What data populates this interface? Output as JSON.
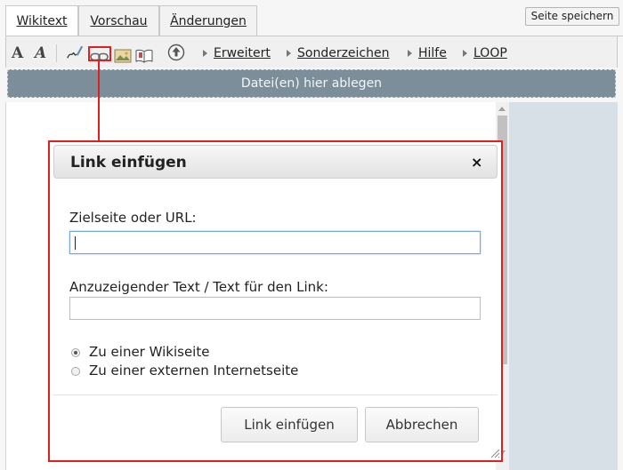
{
  "tabs": [
    {
      "label": "Wikitext"
    },
    {
      "label": "Vorschau"
    },
    {
      "label": "Änderungen"
    }
  ],
  "save_button": "Seite speichern",
  "toolbar": {
    "icons": [
      "bold-icon",
      "italic-icon",
      "signature-icon",
      "link-icon",
      "image-icon",
      "book-icon",
      "upload-icon"
    ],
    "menus": [
      {
        "label": "Erweitert"
      },
      {
        "label": "Sonderzeichen"
      },
      {
        "label": "Hilfe"
      },
      {
        "label": "LOOP"
      }
    ]
  },
  "dropzone": "Datei(en) hier ablegen",
  "dialog": {
    "title": "Link einfügen",
    "close": "×",
    "target_label": "Zielseite oder URL:",
    "target_value": "",
    "text_label": "Anzuzeigender Text / Text für den Link:",
    "text_value": "",
    "radio_options": [
      {
        "label": "Zu einer Wikiseite",
        "checked": true
      },
      {
        "label": "Zu einer externen Internetseite",
        "checked": false
      }
    ],
    "insert_button": "Link einfügen",
    "cancel_button": "Abbrechen"
  },
  "colors": {
    "highlight": "#e02020",
    "dropzone": "#7d8e9b",
    "sidepanel": "#d8e0e7"
  }
}
